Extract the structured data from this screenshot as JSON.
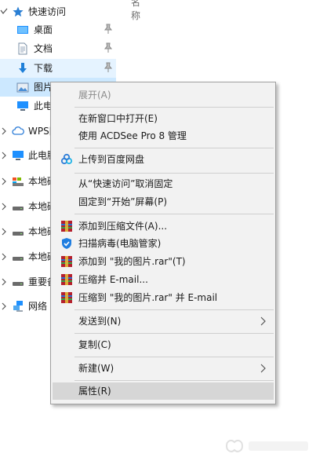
{
  "column_header": "名称",
  "nav": {
    "quick_access": "快速访问",
    "desktop": "桌面",
    "documents": "文档",
    "downloads": "下载",
    "pictures": "图片",
    "this_pc_child": "此电",
    "wps": "WPS网",
    "this_pc": "此电脑",
    "drive1": "本地磁",
    "drive2": "本地磁",
    "drive3": "本地磁",
    "drive4": "本地磁",
    "important": "重要备",
    "network": "网络"
  },
  "menu": {
    "expand": "展开(A)",
    "open_new_window": "在新窗口中打开(E)",
    "acdsee": "使用 ACDSee Pro 8 管理",
    "upload_baidu": "上传到百度网盘",
    "unpin_quick": "从“快速访问”取消固定",
    "pin_start": "固定到“开始”屏幕(P)",
    "add_archive": "添加到压缩文件(A)...",
    "scan_virus": "扫描病毒(电脑管家)",
    "add_rar": "添加到 \"我的图片.rar\"(T)",
    "compress_email": "压缩并 E-mail...",
    "compress_rar_email": "压缩到 \"我的图片.rar\" 并 E-mail",
    "send_to": "发送到(N)",
    "copy": "复制(C)",
    "new": "新建(W)",
    "properties": "属性(R)"
  },
  "colors": {
    "selection": "#cce8ff",
    "hover": "#e5f3ff",
    "menu_bg": "#f2f2f2",
    "menu_hover": "#d6d6d6",
    "folder_blue": "#1e90ff",
    "winrar_red": "#b5202d"
  }
}
